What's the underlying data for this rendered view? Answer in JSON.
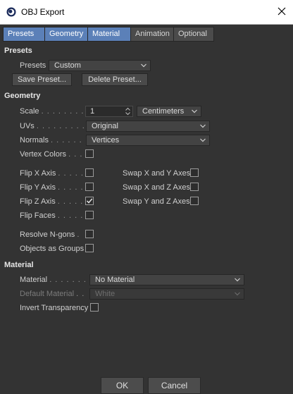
{
  "window": {
    "title": "OBJ Export"
  },
  "tabs": [
    "Presets",
    "Geometry",
    "Material",
    "Animation",
    "Optional"
  ],
  "presets": {
    "heading": "Presets",
    "label": "Presets",
    "value": "Custom",
    "save_label": "Save Preset...",
    "delete_label": "Delete Preset..."
  },
  "geometry": {
    "heading": "Geometry",
    "scale": {
      "label": "Scale",
      "dots": ". . . . . . . .",
      "value": "1",
      "unit": "Centimeters"
    },
    "uvs": {
      "label": "UVs",
      "dots": ". . . . . . . . . .",
      "value": "Original"
    },
    "normals": {
      "label": "Normals",
      "dots": ". . . . . .",
      "value": "Vertices"
    },
    "vertex_colors": {
      "label": "Vertex Colors",
      "dots": ". . .",
      "checked": false
    },
    "flip_x": {
      "label": "Flip X Axis",
      "dots": ". . . . .",
      "checked": false
    },
    "flip_y": {
      "label": "Flip Y Axis",
      "dots": ". . . . .",
      "checked": false
    },
    "flip_z": {
      "label": "Flip Z Axis",
      "dots": ". . . . .",
      "checked": true
    },
    "flip_faces": {
      "label": "Flip Faces",
      "dots": ". . . . .",
      "checked": false
    },
    "swap_xy": {
      "label": "Swap X and Y Axes",
      "checked": false
    },
    "swap_xz": {
      "label": "Swap X and Z Axes",
      "checked": false
    },
    "swap_yz": {
      "label": "Swap Y and Z Axes",
      "checked": false
    },
    "resolve_ngons": {
      "label": "Resolve N-gons",
      "dots": ".",
      "checked": false
    },
    "objects_as_groups": {
      "label": "Objects as Groups",
      "checked": false
    }
  },
  "material": {
    "heading": "Material",
    "material": {
      "label": "Material",
      "dots": ". . . . . . . .",
      "value": "No Material"
    },
    "default_material": {
      "label": "Default Material",
      "dots": ". .",
      "value": "White"
    },
    "invert_transparency": {
      "label": "Invert Transparency",
      "checked": false
    }
  },
  "buttons": {
    "ok": "OK",
    "cancel": "Cancel"
  },
  "colors": {
    "background": "#333333",
    "active_tab": "#5b80b8",
    "titlebar": "#ffffff"
  }
}
